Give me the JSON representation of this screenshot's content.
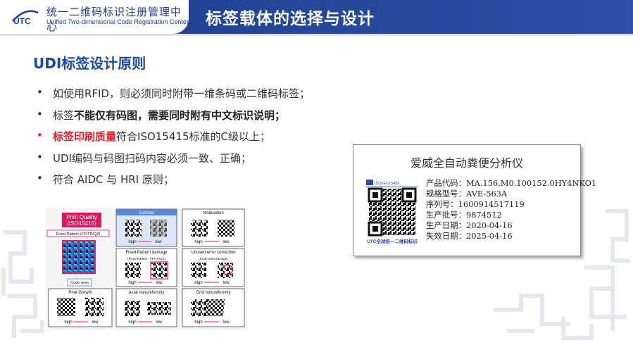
{
  "header": {
    "org_name_cn": "统一二维码标识注册管理中心",
    "org_name_en": "Unified Two-dimensional Code Registration Center",
    "logo_text": "UTC",
    "slide_title": "标签载体的选择与设计"
  },
  "section": {
    "title": "UDI标签设计原则"
  },
  "bullets": [
    {
      "text": "如使用RFID，则必须同时附带一维条码或二维码标签；"
    },
    {
      "pre": "标签",
      "bold": "不能仅有码图，需要同时附有中文标识说明；"
    },
    {
      "red": "标签印刷质量",
      "post": "符合ISO15415标准的C级以上；"
    },
    {
      "text": "UDI编码与码图扫码内容必须一致、正确；"
    },
    {
      "text": "符合 AIDC 与 HRI 原则；"
    }
  ],
  "grades_figure": {
    "print_quality_title": "Print Quality\n(ISO15415)",
    "fixed_pattern_label": "Fixed Pattern (FP/TP/QZ)",
    "code_area_label": "Code area",
    "panels": [
      {
        "title": "Contrast",
        "sub": ""
      },
      {
        "title": "Modulation",
        "sub": ""
      },
      {
        "title": "Fixed Pattern damage",
        "sub": "(Fixed Pattern : FP/TP/QZ)"
      },
      {
        "title": "Unused error correction",
        "sub": "(Code area damage)"
      },
      {
        "title": "Print Growth",
        "sub": ""
      },
      {
        "title": "Axial nonuniformity",
        "sub": ""
      },
      {
        "title": "Grid nonuniformity",
        "sub": ""
      }
    ],
    "high_label": "high",
    "low_label": "low"
  },
  "label_card": {
    "title": "爱威全自动粪便分析仪",
    "iso_label": "ISO/IEC15459",
    "qr_caption": "UTC全球统一二维码标识",
    "fields": [
      {
        "label": "产品代码：",
        "value": "MA.156.M0.100152.0HY4NKO1"
      },
      {
        "label": "规格型号：",
        "value": "AVE-563A"
      },
      {
        "label": "序列号：",
        "value": "1600914517119"
      },
      {
        "label": "生产批号：",
        "value": "9874512"
      },
      {
        "label": "生产日期：",
        "value": "2020-04-16"
      },
      {
        "label": "失效日期：",
        "value": "2025-04-16"
      }
    ]
  },
  "colors": {
    "header_blue": "#1b3f8f",
    "title_blue": "#1b4a9e",
    "accent_red": "#e3202a",
    "pink_banner": "#d81b60",
    "contrast_blue": "#5b86d6"
  }
}
